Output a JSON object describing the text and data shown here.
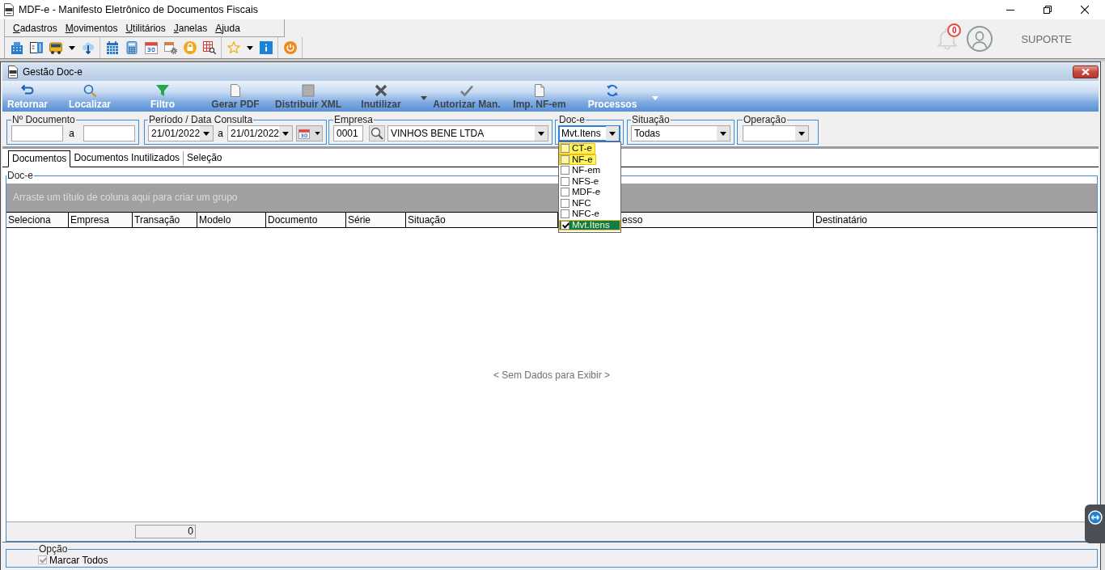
{
  "window": {
    "title": "MDF-e - Manifesto Eletrônico de Documentos Fiscais"
  },
  "menu": [
    "Cadastros",
    "Movimentos",
    "Utilitários",
    "Janelas",
    "Ajuda"
  ],
  "user_area": {
    "notification_count": "0",
    "user_name": "SUPORTE"
  },
  "child_window": {
    "title": "Gestão Doc-e"
  },
  "ribbon": [
    {
      "label": "Retornar",
      "disabled": false,
      "dropdown": false
    },
    {
      "label": "Localizar",
      "disabled": false,
      "dropdown": false
    },
    {
      "label": "Filtro",
      "disabled": false,
      "dropdown": false
    },
    {
      "label": "Gerar PDF",
      "disabled": true,
      "dropdown": false
    },
    {
      "label": "Distribuir XML",
      "disabled": true,
      "dropdown": false
    },
    {
      "label": "Inutilizar",
      "disabled": true,
      "dropdown": true
    },
    {
      "label": "Autorizar Man.",
      "disabled": true,
      "dropdown": false
    },
    {
      "label": "Imp. NF-em",
      "disabled": true,
      "dropdown": false
    },
    {
      "label": "Processos",
      "disabled": false,
      "dropdown": true
    }
  ],
  "filters": {
    "document_number": {
      "label": "Nº Documento",
      "separator": "a"
    },
    "period": {
      "label": "Período / Data Consulta",
      "from": "21/01/2022",
      "separator": "a",
      "to": "21/01/2022"
    },
    "company": {
      "label": "Empresa",
      "code": "0001",
      "name": "VINHOS BENE LTDA"
    },
    "document_type": {
      "label": "Doc-e",
      "value": "Mvt.Itens",
      "focused": true,
      "expanded": true,
      "options": [
        {
          "label": "CT-e",
          "checked": false,
          "selected": false,
          "highlighted": true
        },
        {
          "label": "NF-e",
          "checked": false,
          "selected": false,
          "highlighted": true
        },
        {
          "label": "NF-em",
          "checked": false,
          "selected": false,
          "highlighted": false
        },
        {
          "label": "NFS-e",
          "checked": false,
          "selected": false,
          "highlighted": false
        },
        {
          "label": "MDF-e",
          "checked": false,
          "selected": false,
          "highlighted": false
        },
        {
          "label": "NFC",
          "checked": false,
          "selected": false,
          "highlighted": false
        },
        {
          "label": "NFC-e",
          "checked": false,
          "selected": false,
          "highlighted": false
        },
        {
          "label": "Mvt.Itens",
          "checked": true,
          "selected": true,
          "highlighted": true
        }
      ]
    },
    "status": {
      "label": "Situação",
      "value": "Todas"
    },
    "operation": {
      "label": "Operação"
    }
  },
  "tabs": [
    {
      "label": "Documentos",
      "selected": true
    },
    {
      "label": "Documentos Inutilizados",
      "selected": false
    },
    {
      "label": "Seleção",
      "selected": false
    }
  ],
  "grid": {
    "title": "Doc-e",
    "group_hint": "Arraste um título de coluna aqui para criar um grupo",
    "columns": [
      "Seleciona",
      "Empresa",
      "Transação",
      "Modelo",
      "Documento",
      "Série",
      "Situação",
      "esso",
      "Destinatário"
    ],
    "empty_text": "< Sem Dados para Exibir >",
    "total": "0"
  },
  "options": {
    "title": "Opção",
    "mark_all": {
      "label": "Marcar Todos",
      "checked": true,
      "disabled": true
    }
  }
}
